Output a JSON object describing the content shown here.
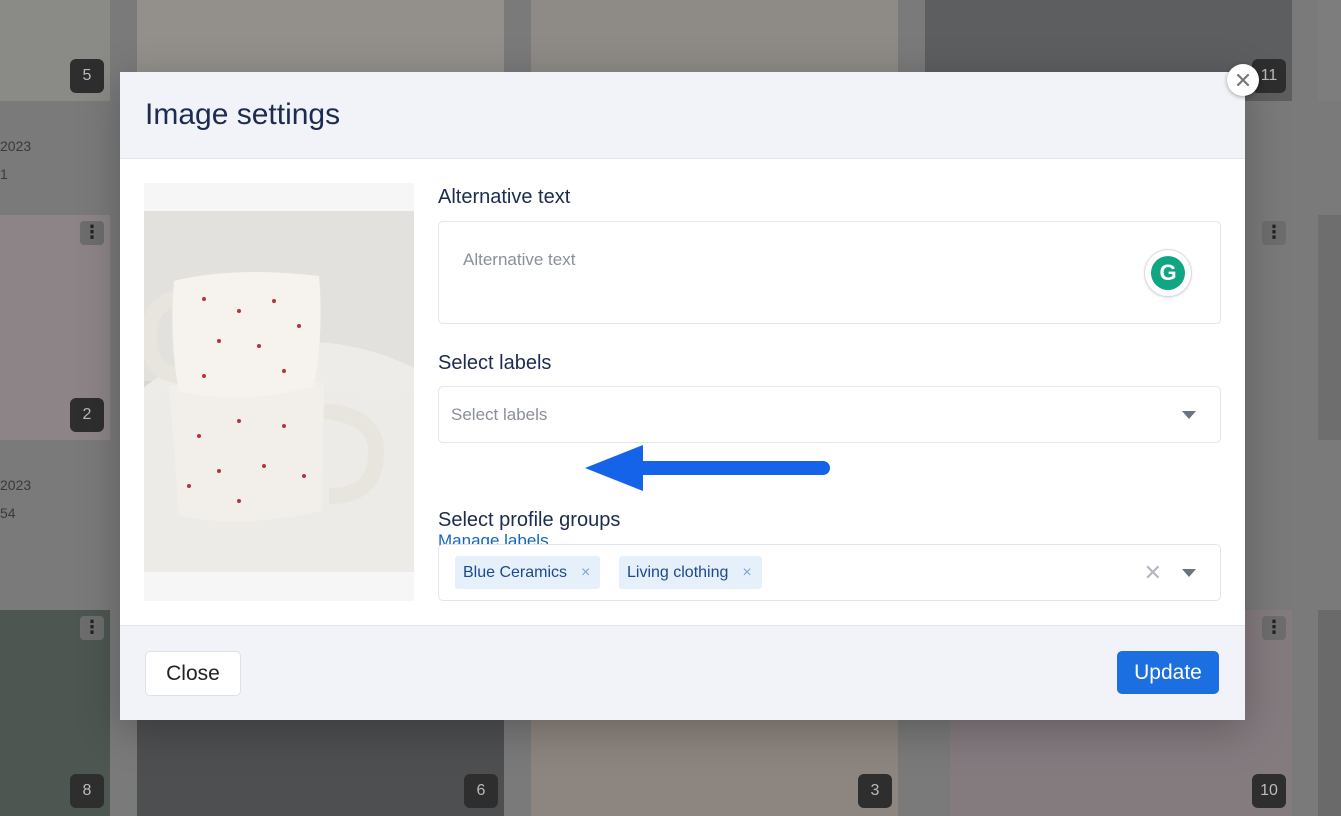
{
  "background": {
    "tile_numbers": [
      "5",
      "11",
      "2",
      "8",
      "6",
      "3",
      "10"
    ],
    "meta_left": [
      "2023",
      "1",
      "2023",
      "54"
    ]
  },
  "modal": {
    "title": "Image settings",
    "alt_text": {
      "label": "Alternative text",
      "placeholder": "Alternative text",
      "value": ""
    },
    "grammarly_icon": "G",
    "labels": {
      "label": "Select labels",
      "placeholder": "Select labels",
      "manage_link": "Manage labels"
    },
    "profile_groups": {
      "label": "Select profile groups",
      "selected": [
        {
          "name": "Blue Ceramics",
          "remove": "×"
        },
        {
          "name": "Living clothing",
          "remove": "×"
        }
      ],
      "clear": "✕"
    },
    "footer": {
      "close_label": "Close",
      "update_label": "Update"
    }
  },
  "colors": {
    "accent": "#1b6fe0",
    "link": "#1565c0",
    "title": "#1c2b4f",
    "annotation_arrow": "#1463e8"
  }
}
